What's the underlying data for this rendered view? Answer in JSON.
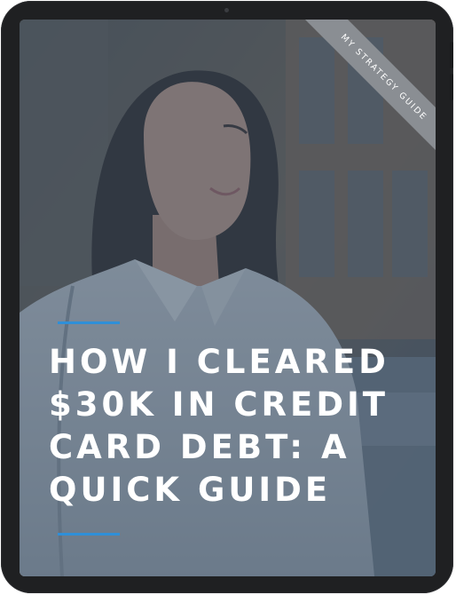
{
  "cover": {
    "ribbon_text": "MY STRATEGY GUIDE",
    "headline": "HOW I CLEARED\n$30K IN CREDIT\nCARD DEBT: A\nQUICK GUIDE",
    "photo": "woman-smiling-outdoors-photo"
  },
  "colors": {
    "device_frame": "#1f2022",
    "overlay_tint": "#34485e",
    "accent_line": "#2f8fd8",
    "ribbon": "#8a8e93",
    "headline_text": "#ffffff"
  },
  "icons": {
    "camera": "front-camera-icon"
  }
}
